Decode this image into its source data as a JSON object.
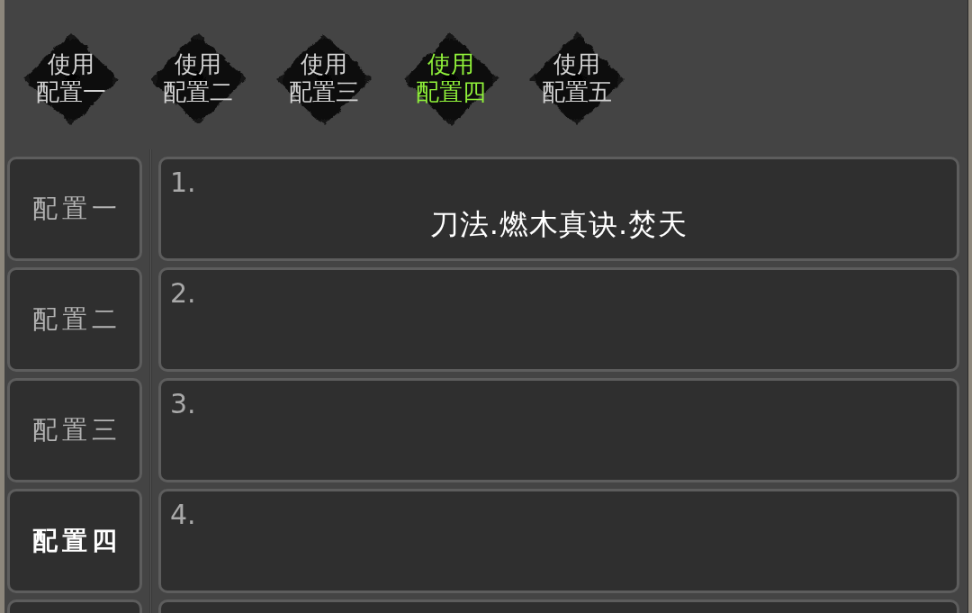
{
  "preset_buttons": [
    {
      "action": "使用",
      "config": "配置一",
      "active": false
    },
    {
      "action": "使用",
      "config": "配置二",
      "active": false
    },
    {
      "action": "使用",
      "config": "配置三",
      "active": false
    },
    {
      "action": "使用",
      "config": "配置四",
      "active": true
    },
    {
      "action": "使用",
      "config": "配置五",
      "active": false
    }
  ],
  "config_panel": {
    "tabs": [
      {
        "label": "配置一",
        "selected": false
      },
      {
        "label": "配置二",
        "selected": false
      },
      {
        "label": "配置三",
        "selected": false
      },
      {
        "label": "配置四",
        "selected": true
      }
    ],
    "slots": [
      {
        "number": "1.",
        "skill": "刀法.燃木真诀.焚天"
      },
      {
        "number": "2."
      },
      {
        "number": "3."
      },
      {
        "number": "4."
      }
    ],
    "continues_below": true
  }
}
